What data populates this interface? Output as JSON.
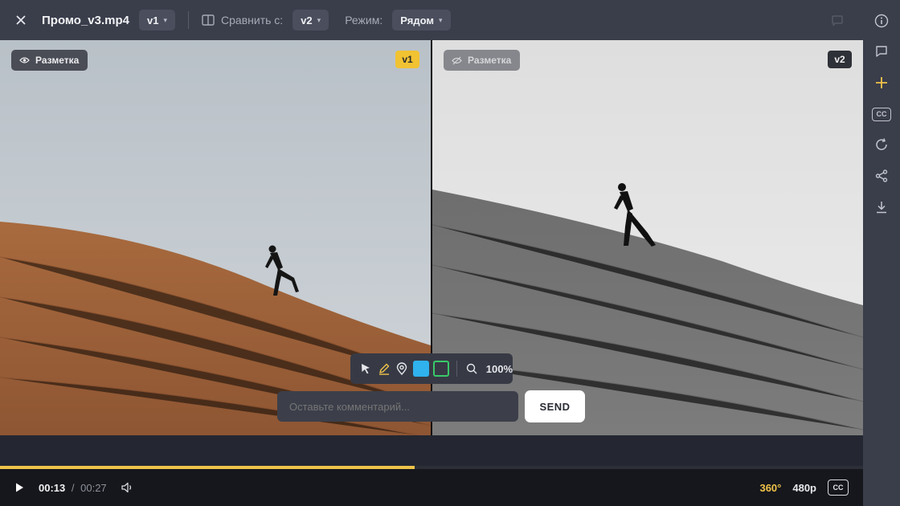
{
  "header": {
    "close_icon": "close-icon",
    "file_title": "Промо_v3.mp4",
    "version_value": "v1",
    "compare_label": "Сравнить с:",
    "compare_value": "v2",
    "mode_label": "Режим:",
    "mode_value": "Рядом"
  },
  "sidebar": {
    "icons": [
      "info-icon",
      "comment-icon",
      "plus-icon",
      "cc-icon",
      "refresh-icon",
      "share-icon",
      "download-icon"
    ],
    "cc_label": "CC",
    "accent": "#f0c34a"
  },
  "viewer": {
    "left": {
      "markup_label": "Разметка",
      "badge": "v1",
      "badge_color": "#f1c232"
    },
    "right": {
      "markup_label": "Разметка",
      "badge": "v2"
    }
  },
  "annotation_tools": {
    "tools": [
      "cursor-icon",
      "pencil-icon",
      "pin-icon"
    ],
    "colors": [
      "#2fb2ee",
      "#39c968"
    ],
    "zoom": "100%"
  },
  "comment": {
    "placeholder": "Оставьте комментарий...",
    "send_label": "SEND"
  },
  "player": {
    "current_time": "00:13",
    "separator": "/",
    "duration": "00:27",
    "progress_fraction": 0.48,
    "vr_label": "360°",
    "resolution": "480p",
    "cc_label": "CC"
  }
}
